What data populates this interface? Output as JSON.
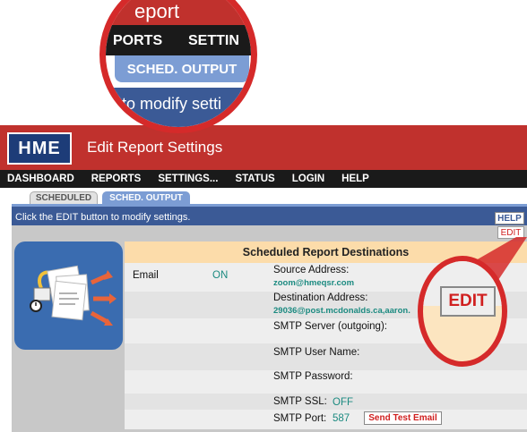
{
  "header": {
    "logo": "HME",
    "title": "Edit Report Settings"
  },
  "nav": {
    "items": [
      "DASHBOARD",
      "REPORTS",
      "SETTINGS...",
      "STATUS",
      "LOGIN",
      "HELP"
    ]
  },
  "tabs": {
    "scheduled": "SCHEDULED",
    "sched_output": "SCHED. OUTPUT"
  },
  "infobar": {
    "text": "Click the EDIT button to modify settings.",
    "help": "HELP"
  },
  "edit_label": "EDIT",
  "panel": {
    "title": "Scheduled Report Destinations",
    "email_label": "Email",
    "email_state": "ON",
    "source_label": "Source Address:",
    "source_value": "zoom@hmeqsr.com",
    "destination_label": "Destination Address:",
    "destination_value": "29036@post.mcdonalds.ca,aaron.",
    "smtp_server_label": "SMTP Server (outgoing):",
    "smtp_user_label": "SMTP User Name:",
    "smtp_password_label": "SMTP Password:",
    "smtp_ssl_label": "SMTP SSL:",
    "smtp_ssl_value": "OFF",
    "smtp_port_label": "SMTP Port:",
    "smtp_port_value": "587",
    "send_test_label": "Send Test Email"
  },
  "zoom_top": {
    "title_fragment": "eport",
    "nav_fragment_1": "PORTS",
    "nav_fragment_2": "SETTIN",
    "tab_label": "SCHED. OUTPUT",
    "info_fragment": "to modify setti"
  },
  "zoom_edit": {
    "label": "EDIT"
  },
  "colors": {
    "header_red": "#c0312d",
    "nav_black": "#1a1a1a",
    "tab_blue": "#7c9dd4",
    "info_blue": "#3b5a96",
    "panel_title_bg": "#fcdcaa",
    "value_teal": "#1b8a80",
    "edit_red": "#d02020",
    "callout_red": "#d52a2a"
  },
  "icons": [
    "report-distribution-icon"
  ]
}
